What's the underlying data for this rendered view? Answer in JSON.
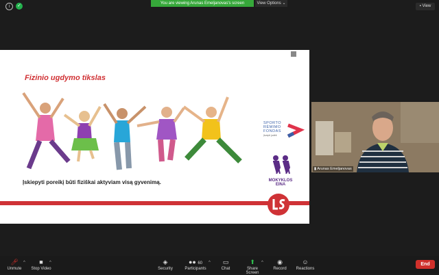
{
  "banner": {
    "text": "You are viewing Arunas Emeljanovas's screen",
    "view_options": "View Options ⌄"
  },
  "top_right": {
    "view": "View"
  },
  "slide": {
    "title": "Fizinio ugdymo tikslas",
    "subtitle": "Įskiepyti poreikį būti fiziškai aktyviam visą gyvenimą.",
    "sport_logo": [
      "SPORTO",
      "RĖMIMO",
      "FONDAS"
    ],
    "sport_logo_tag": "Įkvepti judėti",
    "school_logo": "MOKYKLOS EINA",
    "accent_color": "#d03033"
  },
  "video": {
    "participant_name": "Arunas Emeljanovas"
  },
  "toolbar": {
    "unmute": "Unmute",
    "stop_video": "Stop Video",
    "security": "Security",
    "participants": "Participants",
    "participants_count": "60",
    "chat": "Chat",
    "share_screen": "Share Screen",
    "record": "Record",
    "reactions": "Reactions",
    "end": "End"
  }
}
